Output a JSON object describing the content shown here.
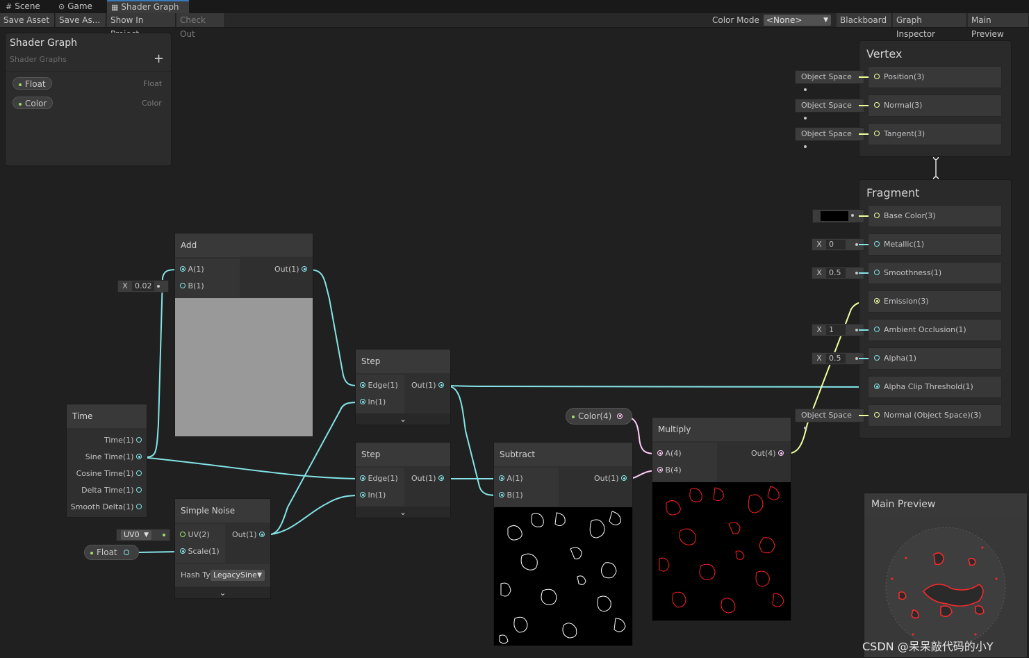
{
  "tabs": [
    {
      "label": "Scene",
      "icon": "#"
    },
    {
      "label": "Game",
      "icon": "⊙"
    },
    {
      "label": "Shader Graph",
      "icon": "▦"
    }
  ],
  "toolbar": {
    "save_asset": "Save Asset",
    "save_as": "Save As...",
    "show_in_project": "Show In Project",
    "check_out": "Check Out",
    "color_mode_label": "Color Mode",
    "color_mode_value": "<None>",
    "blackboard": "Blackboard",
    "graph_inspector": "Graph Inspector",
    "main_preview": "Main Preview"
  },
  "blackboard": {
    "title": "Shader Graph",
    "subtitle": "Shader Graphs",
    "add": "+",
    "properties": [
      {
        "name": "Float",
        "type": "Float"
      },
      {
        "name": "Color",
        "type": "Color"
      }
    ]
  },
  "nodes": {
    "add": {
      "title": "Add",
      "in_a": "A(1)",
      "in_b": "B(1)",
      "out": "Out(1)",
      "b_x": "X",
      "b_value": "0.02"
    },
    "step1": {
      "title": "Step",
      "edge": "Edge(1)",
      "in": "In(1)",
      "out": "Out(1)",
      "expand": "⌄"
    },
    "step2": {
      "title": "Step",
      "edge": "Edge(1)",
      "in": "In(1)",
      "out": "Out(1)",
      "expand": "⌄"
    },
    "time": {
      "title": "Time",
      "outs": [
        "Time(1)",
        "Sine Time(1)",
        "Cosine Time(1)",
        "Delta Time(1)",
        "Smooth Delta(1)"
      ]
    },
    "noise": {
      "title": "Simple Noise",
      "uv": "UV(2)",
      "scale": "Scale(1)",
      "out": "Out(1)",
      "uv_value": "UV0",
      "hash_label": "Hash Ty",
      "hash_value": "LegacySine",
      "expand": "⌄"
    },
    "subtract": {
      "title": "Subtract",
      "a": "A(1)",
      "b": "B(1)",
      "out": "Out(1)"
    },
    "multiply": {
      "title": "Multiply",
      "a": "A(4)",
      "b": "B(4)",
      "out": "Out(4)"
    },
    "color_prop": {
      "label": "Color(4)"
    },
    "float_prop": {
      "label": "Float"
    }
  },
  "master": {
    "vertex_title": "Vertex",
    "fragment_title": "Fragment",
    "vertex_slots": [
      {
        "label": "Position(3)",
        "space": "Object Space"
      },
      {
        "label": "Normal(3)",
        "space": "Object Space"
      },
      {
        "label": "Tangent(3)",
        "space": "Object Space"
      }
    ],
    "fragment_slots": [
      {
        "label": "Base Color(3)",
        "control": "color",
        "value": "#000000"
      },
      {
        "label": "Metallic(1)",
        "control": "X",
        "value": "0"
      },
      {
        "label": "Smoothness(1)",
        "control": "X",
        "value": "0.5"
      },
      {
        "label": "Emission(3)",
        "control": "",
        "value": ""
      },
      {
        "label": "Ambient Occlusion(1)",
        "control": "X",
        "value": "1"
      },
      {
        "label": "Alpha(1)",
        "control": "X",
        "value": "0.5"
      },
      {
        "label": "Alpha Clip Threshold(1)",
        "control": "",
        "value": ""
      },
      {
        "label": "Normal (Object Space)(3)",
        "control": "space",
        "value": "Object Space"
      }
    ]
  },
  "preview": {
    "title": "Main Preview"
  },
  "watermark": "CSDN @呆呆敲代码的小Y",
  "colors": {
    "float_port": "#84e4e7",
    "vector3_port": "#f1ff9f",
    "vector4_port": "#fbcbf4",
    "accent": "#3a79bb"
  }
}
